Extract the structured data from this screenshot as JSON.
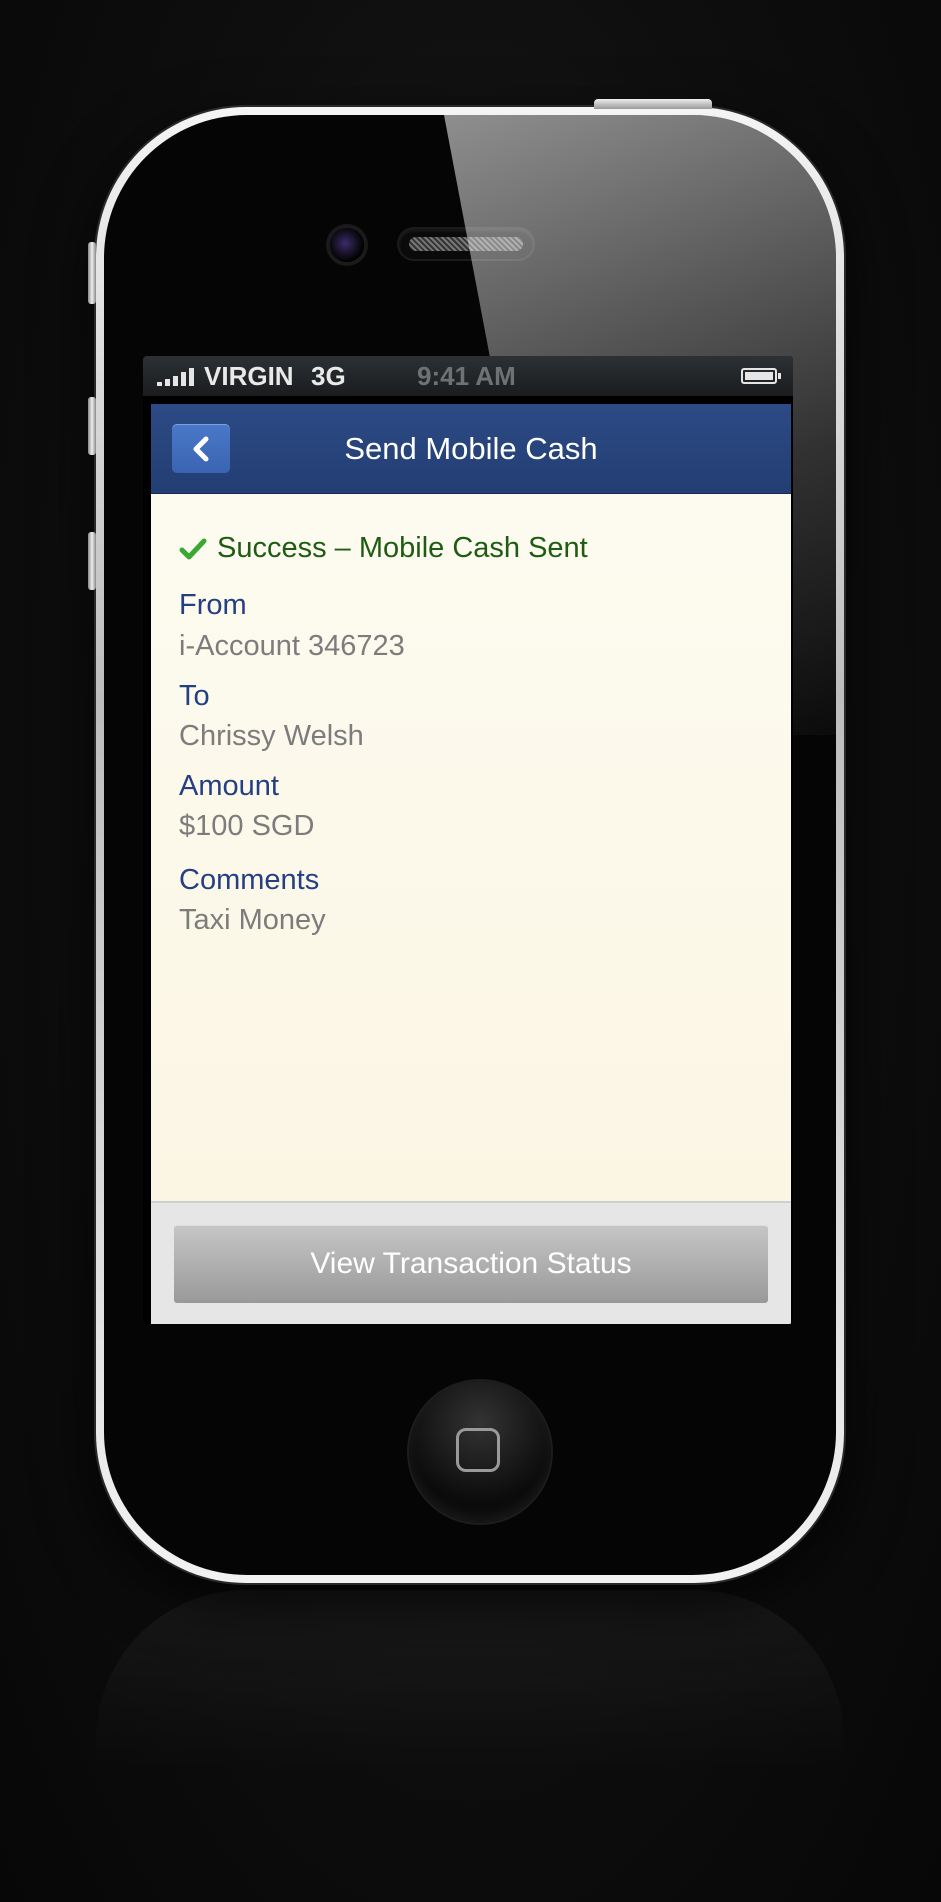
{
  "status_bar": {
    "carrier": "VIRGIN",
    "network": "3G",
    "time": "9:41 AM",
    "icons": [
      "signal-icon",
      "battery-icon"
    ]
  },
  "nav": {
    "title": "Send Mobile Cash",
    "back_icon": "chevron-left-icon"
  },
  "confirmation": {
    "icon": "checkmark-icon",
    "message": "Success – Mobile Cash Sent"
  },
  "details": {
    "from": {
      "label": "From",
      "value": "i-Account 346723"
    },
    "to": {
      "label": "To",
      "value": "Chrissy Welsh"
    },
    "amount": {
      "label": "Amount",
      "value": "$100 SGD"
    },
    "comments": {
      "label": "Comments",
      "value": "Taxi Money"
    }
  },
  "footer": {
    "button_label": "View Transaction Status"
  },
  "colors": {
    "navbar": "#233e73",
    "back_button": "#3a64b2",
    "success_text": "#1e5c12",
    "check_icon": "#3aa832",
    "label_text": "#243f82",
    "value_text": "#7c7c7c",
    "content_bg": "#fdfbf0",
    "button_bg": "#a9a9a9"
  }
}
